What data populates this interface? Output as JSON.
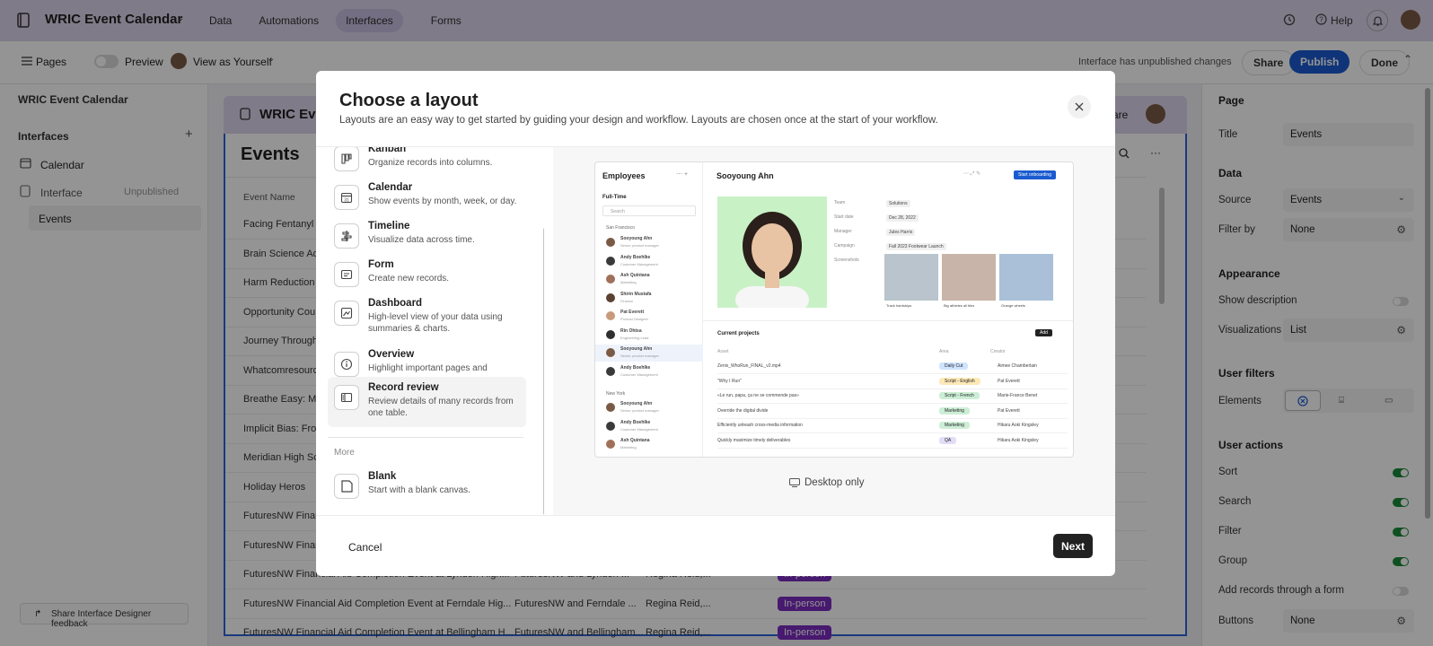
{
  "topbar": {
    "app_title": "WRIC Event Calendar",
    "tabs": [
      "Data",
      "Automations",
      "Interfaces",
      "Forms"
    ],
    "active_tab": "Interfaces",
    "help_label": "Help"
  },
  "toolbar": {
    "pages_label": "Pages",
    "preview_label": "Preview",
    "view_as_label": "View as Yourself",
    "unpublished_notice": "Interface has unpublished changes",
    "share_label": "Share",
    "publish_label": "Publish",
    "done_label": "Done"
  },
  "left_panel": {
    "base_title": "WRIC Event Calendar",
    "section_label": "Interfaces",
    "items": [
      {
        "label": "Calendar"
      },
      {
        "label": "Interface",
        "badge": "Unpublished"
      },
      {
        "label": "Events"
      }
    ],
    "feedback_label": "Share Interface Designer feedback"
  },
  "canvas": {
    "header_title": "WRIC Ev",
    "share_fragment": "are",
    "page_title": "Events",
    "column_header": "Event Name",
    "rows": [
      {
        "name": "Facing Fentanyl T"
      },
      {
        "name": "Brain Science Ad"
      },
      {
        "name": "Harm Reduction"
      },
      {
        "name": "Opportunity Cou"
      },
      {
        "name": "Journey Through"
      },
      {
        "name": "Whatcomresourc"
      },
      {
        "name": "Breathe Easy: Me"
      },
      {
        "name": "Implicit Bias: Fro"
      },
      {
        "name": "Meridian High Sc"
      },
      {
        "name": "Holiday Heros"
      },
      {
        "name": "FuturesNW Finar"
      },
      {
        "name": "FuturesNW Finar"
      },
      {
        "name": "FuturesNW Financial Aid Completion Event at Lynden High...",
        "org": "FuturesNW and Lynden ...",
        "contact": "Regina Reid,...",
        "type": "In-person"
      },
      {
        "name": "FuturesNW Financial Aid Completion Event at Ferndale Hig...",
        "org": "FuturesNW and Ferndale ...",
        "contact": "Regina Reid,...",
        "type": "In-person"
      },
      {
        "name": "FuturesNW Financial Aid Completion Event at Bellingham H...",
        "org": "FuturesNW and Bellingham...",
        "contact": "Regina Reid,...",
        "type": "In-person"
      }
    ],
    "type_color": "#7b2cbf"
  },
  "right_panel": {
    "page_section": "Page",
    "title_label": "Title",
    "title_value": "Events",
    "data_section": "Data",
    "source_label": "Source",
    "source_value": "Events",
    "filter_label": "Filter by",
    "filter_value": "None",
    "appearance_section": "Appearance",
    "show_description_label": "Show description",
    "visualizations_label": "Visualizations",
    "visualizations_value": "List",
    "user_filters_section": "User filters",
    "elements_label": "Elements",
    "user_actions_section": "User actions",
    "actions": [
      {
        "label": "Sort",
        "on": true
      },
      {
        "label": "Search",
        "on": true
      },
      {
        "label": "Filter",
        "on": true
      },
      {
        "label": "Group",
        "on": true
      },
      {
        "label": "Add records through a form",
        "on": false
      }
    ],
    "buttons_label": "Buttons",
    "buttons_value": "None",
    "toggle_on_color": "#1a8a3a"
  },
  "modal": {
    "title": "Choose a layout",
    "subtitle": "Layouts are an easy way to get started by guiding your design and workflow. Layouts are chosen once at the start of your workflow.",
    "layouts": [
      {
        "title": "Kanban",
        "desc": "Organize records into columns.",
        "icon": "kanban-icon"
      },
      {
        "title": "Calendar",
        "desc": "Show events by month, week, or day.",
        "icon": "calendar-icon"
      },
      {
        "title": "Timeline",
        "desc": "Visualize data across time.",
        "icon": "timeline-icon"
      },
      {
        "title": "Form",
        "desc": "Create new records.",
        "icon": "form-icon"
      },
      {
        "title": "Dashboard",
        "desc": "High-level view of your data using summaries & charts.",
        "icon": "dashboard-icon"
      },
      {
        "title": "Overview",
        "desc": "Highlight important pages and resources",
        "icon": "info-icon"
      },
      {
        "title": "Record review",
        "desc": "Review details of many records from one table.",
        "icon": "record-review-icon",
        "selected": true
      }
    ],
    "more_label": "More",
    "blank": {
      "title": "Blank",
      "desc": "Start with a blank canvas."
    },
    "desktop_only_label": "Desktop only",
    "cancel_label": "Cancel",
    "next_label": "Next",
    "preview": {
      "list_title": "Employees",
      "filter_label": "Full-Time",
      "search_placeholder": "Search",
      "group_1": "San Francisco",
      "group_2": "New York",
      "people": [
        {
          "name": "Sooyoung Ahn",
          "role": "Senior product manager"
        },
        {
          "name": "Andy Boehlke",
          "role": "Customer Management"
        },
        {
          "name": "Ash Quintana",
          "role": "Marketing"
        },
        {
          "name": "Shirin Mustafa",
          "role": "Finance"
        },
        {
          "name": "Pat Everett",
          "role": "Product Designer"
        },
        {
          "name": "Rin Ohtsa",
          "role": "Engineering Lead"
        },
        {
          "name": "Sooyoung Ahn",
          "role": "Senior product manager"
        },
        {
          "name": "Andy Boehlke",
          "role": "Customer Management"
        }
      ],
      "people_ny": [
        {
          "name": "Sooyoung Ahn",
          "role": "Senior product manager"
        },
        {
          "name": "Andy Boehlke",
          "role": "Customer Management"
        },
        {
          "name": "Ash Quintana",
          "role": "Marketing"
        }
      ],
      "detail_name": "Sooyoung Ahn",
      "start_button": "Start onboarding",
      "fields": [
        {
          "k": "Team",
          "v": "Solutions"
        },
        {
          "k": "Start date",
          "v": "Dec 28, 2022"
        },
        {
          "k": "Manager",
          "v": "Jules Harris"
        },
        {
          "k": "Campaign",
          "v": "Fall 2023 Footwear Launch"
        },
        {
          "k": "Screenshots",
          "v": ""
        }
      ],
      "thumb_captions": [
        "Track hardships",
        "Big athletes all tiles",
        "Orange wheels"
      ],
      "projects_title": "Current projects",
      "add_label": "Add",
      "proj_cols": [
        "Asset",
        "Area",
        "Creator"
      ],
      "projects": [
        {
          "asset": "Zenix_WhoRun_FINAL_v2.mp4",
          "area": "Daily Cut",
          "creator": "Aimee Chamberlain",
          "color": "#cfe3ff"
        },
        {
          "asset": "\"Why I Run\"",
          "area": "Script - English",
          "creator": "Pat Everett",
          "color": "#fde9b8"
        },
        {
          "asset": "«Le run, papa, ça ne se commende pas»",
          "area": "Script - French",
          "creator": "Marie-France Benet",
          "color": "#cdeed6"
        },
        {
          "asset": "Override the digital divide",
          "area": "Marketing",
          "creator": "Pat Everett",
          "color": "#cdeed6"
        },
        {
          "asset": "Efficiently unleash cross-media information",
          "area": "Marketing",
          "creator": "Hikaru Aoki Kingsley",
          "color": "#cdeed6"
        },
        {
          "asset": "Quickly maximize timely deliverables",
          "area": "QA",
          "creator": "Hikaru Aoki Kingsley",
          "color": "#e3dcf7"
        }
      ]
    }
  }
}
